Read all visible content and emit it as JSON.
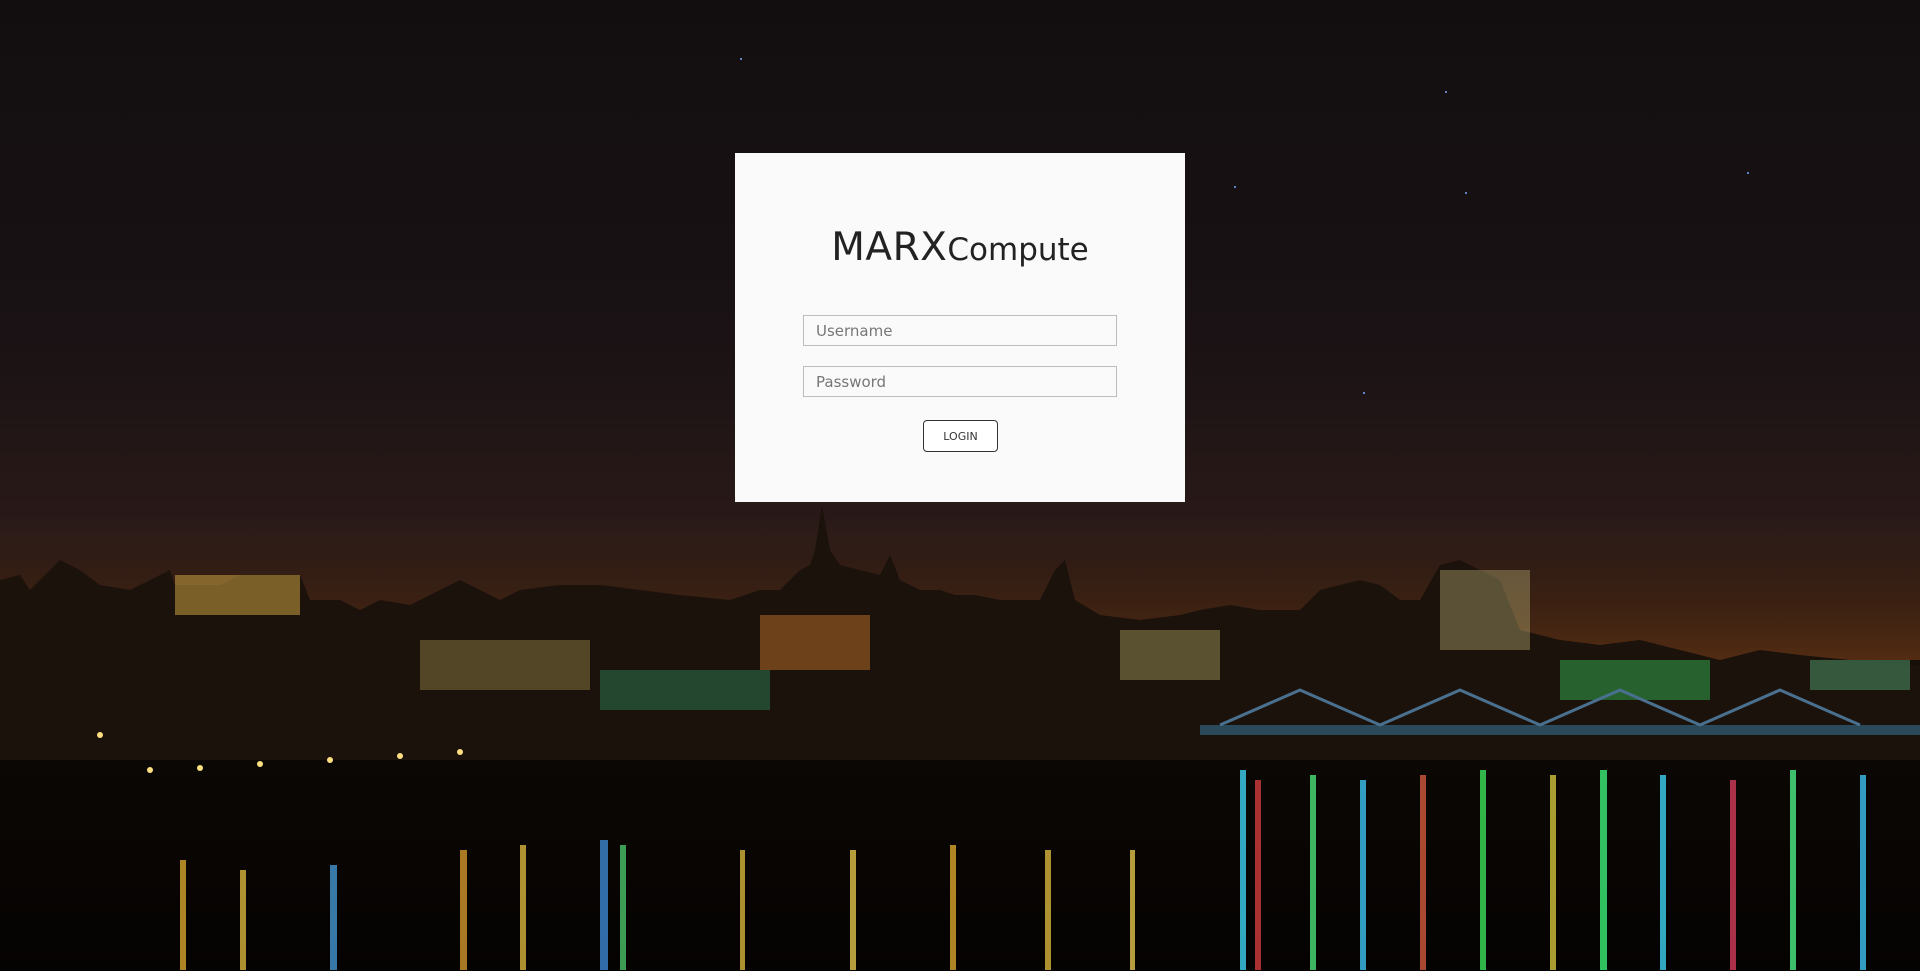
{
  "brand": {
    "strong": "MARX",
    "light": "Compute"
  },
  "form": {
    "username_placeholder": "Username",
    "username_value": "",
    "password_placeholder": "Password",
    "password_value": "",
    "login_label": "LOGIN"
  },
  "background": {
    "description_icon": "city-skyline-night-background"
  }
}
